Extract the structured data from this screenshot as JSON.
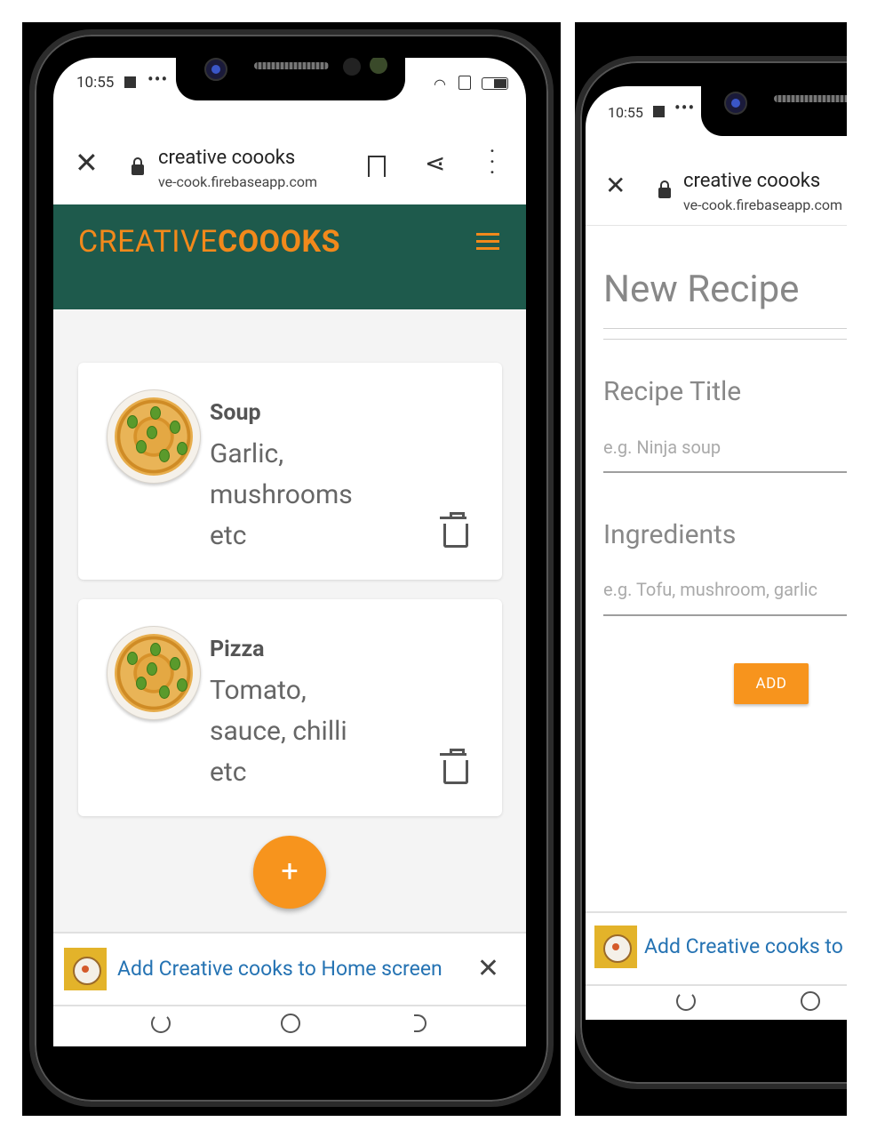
{
  "status": {
    "time": "10:55",
    "dots": "•••"
  },
  "browser": {
    "title": "creative coooks",
    "url": "ve-cook.firebaseapp.com"
  },
  "app": {
    "logo_light": "CREATIVE",
    "logo_bold": "COOOKS"
  },
  "recipes": [
    {
      "title": "Soup",
      "ingredients": "Garlic, mushrooms etc"
    },
    {
      "title": "Pizza",
      "ingredients": "Tomato, sauce, chilli etc"
    }
  ],
  "fab": {
    "label": "+"
  },
  "a2hs": {
    "left_text": "Add Creative cooks to Home screen",
    "right_text": "Add Creative cooks to I",
    "close": "✕"
  },
  "form": {
    "title": "New Recipe",
    "recipe_title_label": "Recipe Title",
    "recipe_title_placeholder": "e.g. Ninja soup",
    "ingredients_label": "Ingredients",
    "ingredients_placeholder": "e.g. Tofu, mushroom, garlic",
    "add_button": "ADD"
  },
  "colors": {
    "header": "#1e5a4c",
    "accent": "#f7941d",
    "link": "#2573b3"
  }
}
